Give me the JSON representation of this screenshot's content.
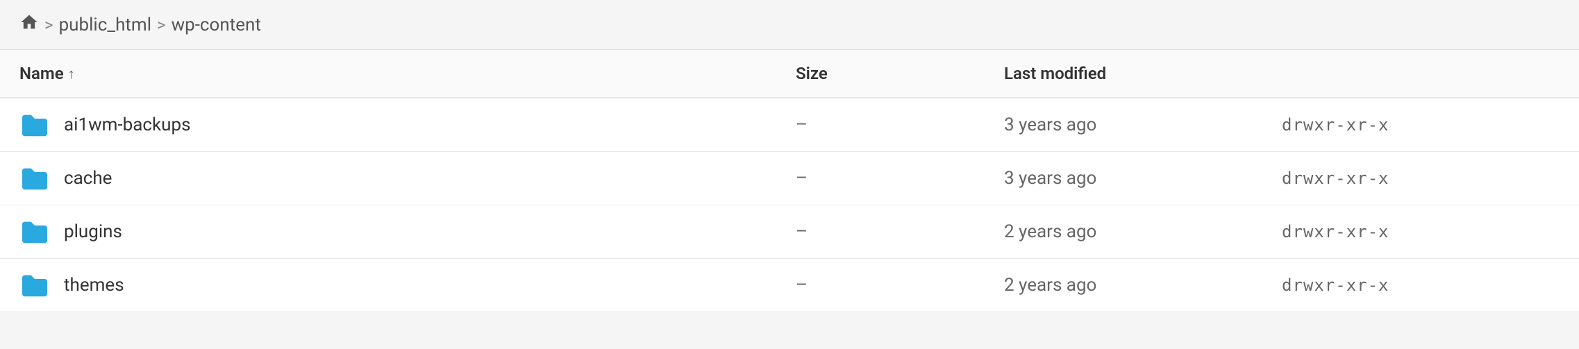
{
  "breadcrumb": {
    "home_icon": "⌂",
    "separator": ">",
    "items": [
      {
        "label": "public_html"
      },
      {
        "label": "wp-content"
      }
    ]
  },
  "table": {
    "columns": [
      {
        "label": "Name",
        "sort": "↑"
      },
      {
        "label": "Size"
      },
      {
        "label": "Last modified"
      },
      {
        "label": ""
      }
    ],
    "rows": [
      {
        "name": "ai1wm-backups",
        "size": "–",
        "modified": "3 years ago",
        "permissions": "drwxr-xr-x"
      },
      {
        "name": "cache",
        "size": "–",
        "modified": "3 years ago",
        "permissions": "drwxr-xr-x"
      },
      {
        "name": "plugins",
        "size": "–",
        "modified": "2 years ago",
        "permissions": "drwxr-xr-x"
      },
      {
        "name": "themes",
        "size": "–",
        "modified": "2 years ago",
        "permissions": "drwxr-xr-x"
      }
    ]
  },
  "colors": {
    "folder": "#29a9e0",
    "accent": "#2196F3"
  }
}
